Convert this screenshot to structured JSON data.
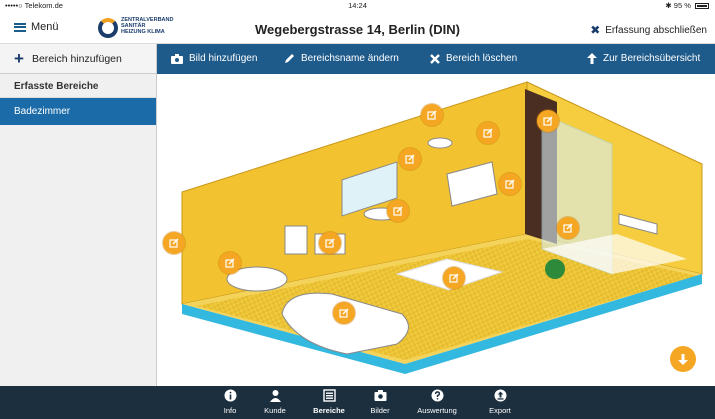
{
  "status_bar": {
    "carrier": "•••••○ Telekom.de",
    "time": "14:24",
    "battery": "95 %"
  },
  "header": {
    "menu_label": "Menü",
    "logo_lines": [
      "ZENTRALVERBAND",
      "SANITÄR",
      "HEIZUNG KLIMA"
    ],
    "title": "Wegebergstrasse 14, Berlin (DIN)",
    "finish_label": "Erfassung abschließen"
  },
  "toolbar": {
    "add_area": "Bereich hinzufügen",
    "add_image": "Bild hinzufügen",
    "rename_area": "Bereichsname ändern",
    "delete_area": "Bereich löschen",
    "overview": "Zur Bereichsübersicht"
  },
  "sidebar": {
    "header": "Erfasste Bereiche",
    "items": [
      {
        "label": "Badezimmer"
      }
    ]
  },
  "tabs": [
    {
      "label": "Info",
      "icon": "info-icon"
    },
    {
      "label": "Kunde",
      "icon": "person-icon"
    },
    {
      "label": "Bereiche",
      "icon": "list-icon",
      "active": true
    },
    {
      "label": "Bilder",
      "icon": "camera-icon"
    },
    {
      "label": "Auswertung",
      "icon": "question-icon"
    },
    {
      "label": "Export",
      "icon": "export-icon"
    }
  ],
  "colors": {
    "accent": "#1e5a8a",
    "marker": "#f5a623",
    "wall": "#f2c230",
    "floor_edge": "#33b8e0",
    "tabbar": "#1c2f3e"
  }
}
